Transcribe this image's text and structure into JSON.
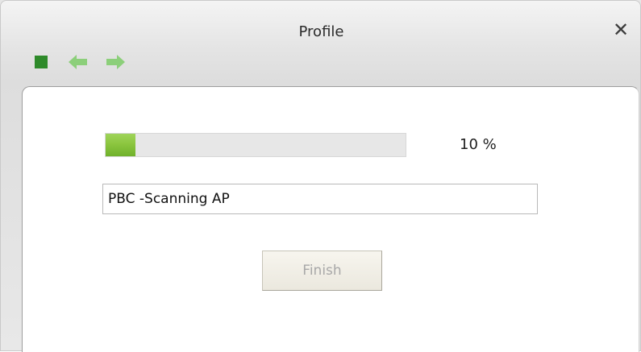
{
  "window": {
    "title": "Profile",
    "close_symbol": "✕"
  },
  "toolbar": {
    "buttons": [
      {
        "name": "stop",
        "icon": "stop-square-icon",
        "color": "#2e8a2a"
      },
      {
        "name": "back",
        "icon": "arrow-left-icon",
        "color": "#8ccf7a"
      },
      {
        "name": "forward",
        "icon": "arrow-right-icon",
        "color": "#8ccf7a"
      }
    ]
  },
  "progress": {
    "value_percent": 10,
    "label": "10 %",
    "fill_color": "#8cc63f"
  },
  "status": {
    "value": "PBC -Scanning AP"
  },
  "actions": {
    "finish_label": "Finish",
    "finish_enabled": false
  }
}
